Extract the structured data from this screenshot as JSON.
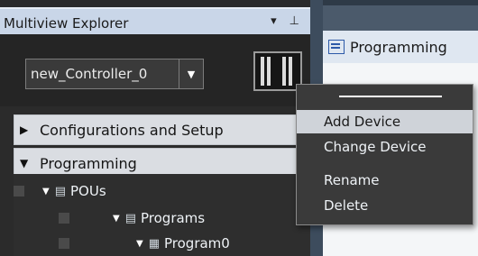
{
  "explorer": {
    "title": "Multiview Explorer",
    "dropdown_icon": "▾",
    "pin_icon": "P"
  },
  "controller": {
    "selected": "new_Controller_0",
    "arrow": "▼"
  },
  "tree": {
    "sections": [
      {
        "label": "Configurations and Setup",
        "expanded": false
      },
      {
        "label": "Programming",
        "expanded": true
      }
    ],
    "items": [
      {
        "label": "POUs",
        "icon": "▤"
      },
      {
        "label": "Programs",
        "icon": "▤"
      },
      {
        "label": "Program0",
        "icon": "▦"
      }
    ]
  },
  "right_panel": {
    "tab_label": "Programming"
  },
  "context_menu": {
    "items": [
      {
        "label": "Add Device",
        "highlighted": true
      },
      {
        "label": "Change Device",
        "highlighted": false
      },
      {
        "label": "Rename",
        "highlighted": false
      },
      {
        "label": "Delete",
        "highlighted": false
      }
    ]
  }
}
